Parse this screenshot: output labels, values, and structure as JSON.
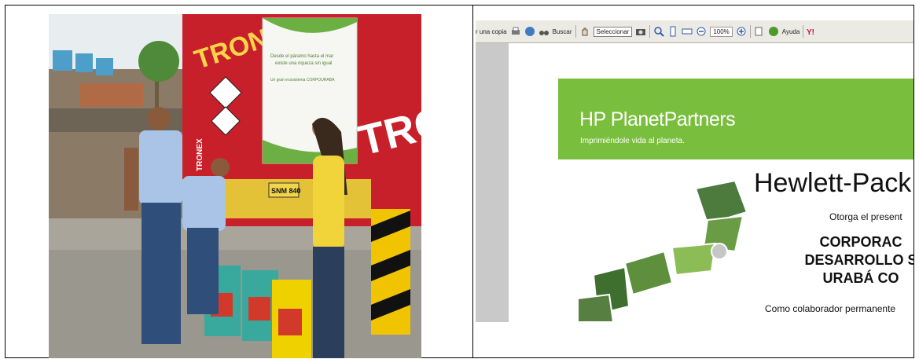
{
  "photo": {
    "truck_text_1": "TRONE",
    "truck_text_2": "TRONE",
    "truck_side_text": "TRONEX",
    "plate": "SNM 840",
    "banner_quote_1": "Desde el páramo hasta el mar",
    "banner_quote_2": "existe una riqueza sin igual",
    "banner_quote_3": "Un gran ecosistema CORPOURABA"
  },
  "toolbar": {
    "save_copy_label": "r una copia",
    "search_label": "Buscar",
    "select_label": "Seleccionar",
    "zoom_value": "100%",
    "help_label": "Ayuda"
  },
  "document": {
    "brand_bold": "HP Planet",
    "brand_light": "Partners",
    "tagline": "Imprimiéndole vida al planeta.",
    "heading": "Hewlett-Pack",
    "grants": "Otorga el present",
    "org_line_1": "CORPORAC",
    "org_line_2": "DESARROLLO S",
    "org_line_3": "URABÁ CO",
    "footer": "Como colaborador permanente"
  },
  "colors": {
    "banner_green": "#79be3d",
    "truck_red": "#c8202a",
    "shirt_yellow": "#f1d43a"
  }
}
